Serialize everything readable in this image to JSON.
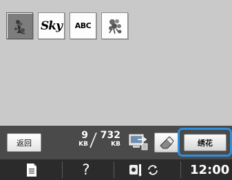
{
  "thumbnails": [
    {
      "kind": "image",
      "icon": "flower-embroidery-icon",
      "selected": true
    },
    {
      "kind": "text",
      "label": "Sky"
    },
    {
      "kind": "text",
      "label": "ABC"
    },
    {
      "kind": "image",
      "icon": "floral-embroidery-icon",
      "selected": false
    }
  ],
  "toolbar": {
    "return_label": "返回",
    "memory_used": "9",
    "memory_used_unit": "KB",
    "memory_total": "732",
    "memory_total_unit": "KB",
    "embroider_label": "绣花"
  },
  "statusbar": {
    "help_label": "?",
    "time": "12:00"
  },
  "colors": {
    "highlight": "#2f8fe0",
    "toolbar_bg": "#4a4a4a",
    "statusbar_bg": "#2b2b2b",
    "main_bg": "#c9c9c9"
  }
}
